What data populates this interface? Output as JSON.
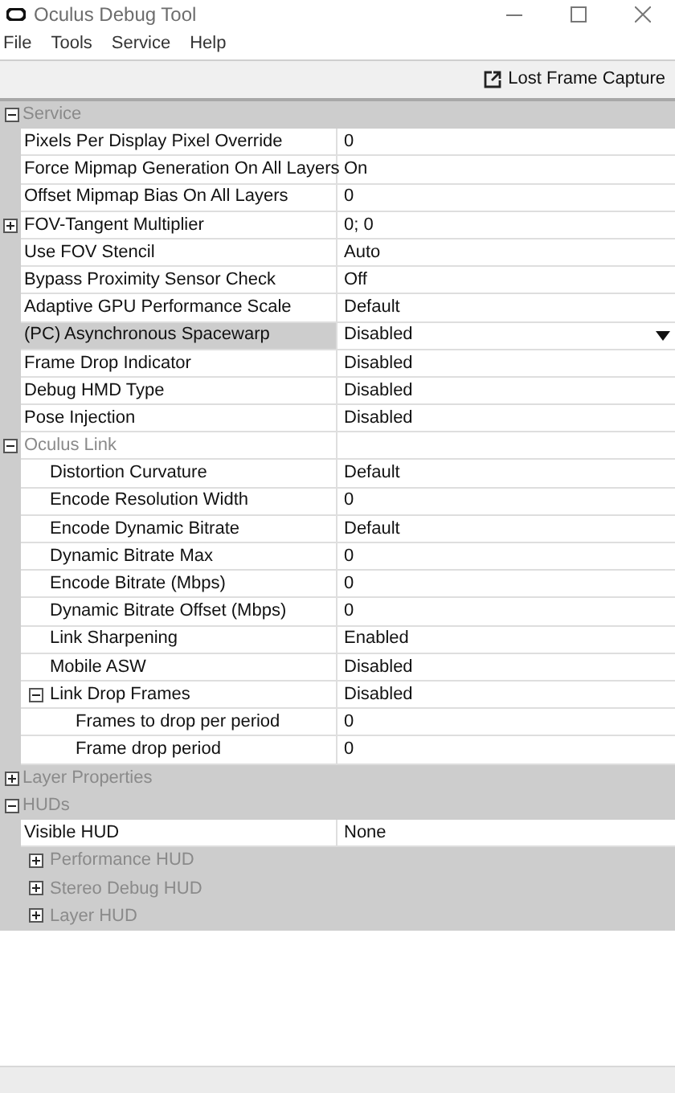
{
  "window": {
    "title": "Oculus Debug Tool"
  },
  "menu": [
    "File",
    "Tools",
    "Service",
    "Help"
  ],
  "toolbar": {
    "button": "Lost Frame Capture"
  },
  "grid": [
    {
      "kind": "category",
      "label": "Service",
      "expanded": true,
      "children": [
        {
          "kind": "property",
          "label": "Pixels Per Display Pixel Override",
          "value": "0",
          "selected": false
        },
        {
          "kind": "property",
          "label": "Force Mipmap Generation On All Layers",
          "value": "On",
          "selected": false
        },
        {
          "kind": "property",
          "label": "Offset Mipmap Bias On All Layers",
          "value": "0",
          "selected": false
        },
        {
          "kind": "property",
          "label": "FOV-Tangent Multiplier",
          "value": "0; 0",
          "selected": false,
          "expanded": false
        },
        {
          "kind": "property",
          "label": "Use FOV Stencil",
          "value": "Auto",
          "selected": false
        },
        {
          "kind": "property",
          "label": "Bypass Proximity Sensor Check",
          "value": "Off",
          "selected": false
        },
        {
          "kind": "property",
          "label": "Adaptive GPU Performance Scale",
          "value": "Default",
          "selected": false
        },
        {
          "kind": "property",
          "label": "(PC) Asynchronous Spacewarp",
          "value": "Disabled",
          "selected": true
        },
        {
          "kind": "property",
          "label": "Frame Drop Indicator",
          "value": "Disabled",
          "selected": false
        },
        {
          "kind": "property",
          "label": "Debug HMD Type",
          "value": "Disabled",
          "selected": false
        },
        {
          "kind": "property",
          "label": "Pose Injection",
          "value": "Disabled",
          "selected": false
        },
        {
          "kind": "group",
          "label": "Oculus Link",
          "expanded": true,
          "children": [
            {
              "kind": "property",
              "label": "Distortion Curvature",
              "value": "Default",
              "selected": false
            },
            {
              "kind": "property",
              "label": "Encode Resolution Width",
              "value": "0",
              "selected": false
            },
            {
              "kind": "property",
              "label": "Encode Dynamic Bitrate",
              "value": "Default",
              "selected": false
            },
            {
              "kind": "property",
              "label": "Dynamic Bitrate Max",
              "value": "0",
              "selected": false
            },
            {
              "kind": "property",
              "label": "Encode Bitrate (Mbps)",
              "value": "0",
              "selected": false
            },
            {
              "kind": "property",
              "label": "Dynamic Bitrate Offset (Mbps)",
              "value": "0",
              "selected": false
            },
            {
              "kind": "property",
              "label": "Link Sharpening",
              "value": "Enabled",
              "selected": false
            },
            {
              "kind": "property",
              "label": "Mobile ASW",
              "value": "Disabled",
              "selected": false
            },
            {
              "kind": "property",
              "label": "Link Drop Frames",
              "value": "Disabled",
              "selected": false,
              "expanded": true,
              "children": [
                {
                  "kind": "property",
                  "label": "Frames to drop per period",
                  "value": "0",
                  "selected": false
                },
                {
                  "kind": "property",
                  "label": "Frame drop period",
                  "value": "0",
                  "selected": false
                }
              ]
            }
          ]
        }
      ]
    },
    {
      "kind": "category",
      "label": "Layer Properties",
      "expanded": false
    },
    {
      "kind": "category",
      "label": "HUDs",
      "expanded": true,
      "children": [
        {
          "kind": "property",
          "label": "Visible HUD",
          "value": "None",
          "selected": false
        },
        {
          "kind": "category",
          "label": "Performance HUD",
          "expanded": false
        },
        {
          "kind": "category",
          "label": "Stereo Debug HUD",
          "expanded": false
        },
        {
          "kind": "category",
          "label": "Layer HUD",
          "expanded": false
        }
      ]
    }
  ]
}
